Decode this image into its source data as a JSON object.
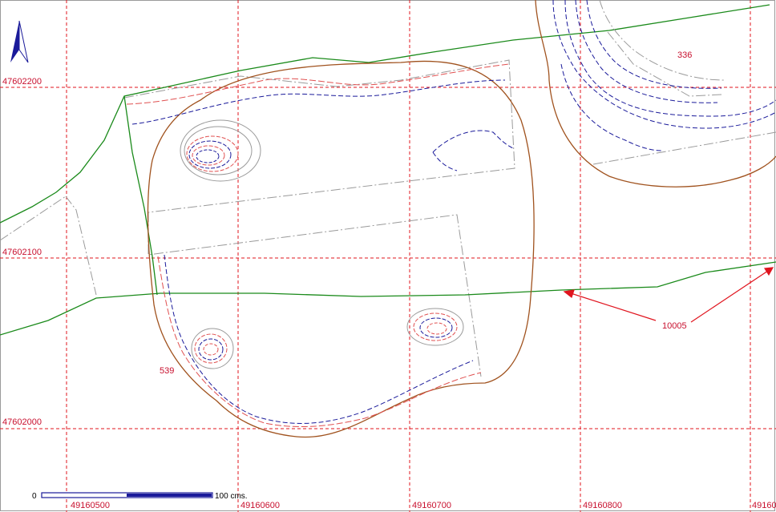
{
  "map": {
    "grid_labels_y": [
      "47602200",
      "47602100",
      "47602000"
    ],
    "grid_labels_x": [
      "49160500",
      "49160600",
      "49160700",
      "49160800",
      "49160"
    ],
    "feature_labels": [
      "336",
      "539",
      "10005"
    ],
    "scale_bar": {
      "start": "0",
      "end": "100 cms."
    },
    "north_arrow": "north-arrow-icon",
    "colors": {
      "grid": "#e0141e",
      "limit_green": "#1a8a1a",
      "cut_brown": "#a0521e",
      "contour_blue": "#1a1a9a",
      "contour_red": "#e05050",
      "contour_gray": "#9a9a9a",
      "label_red": "#c8102e"
    }
  }
}
